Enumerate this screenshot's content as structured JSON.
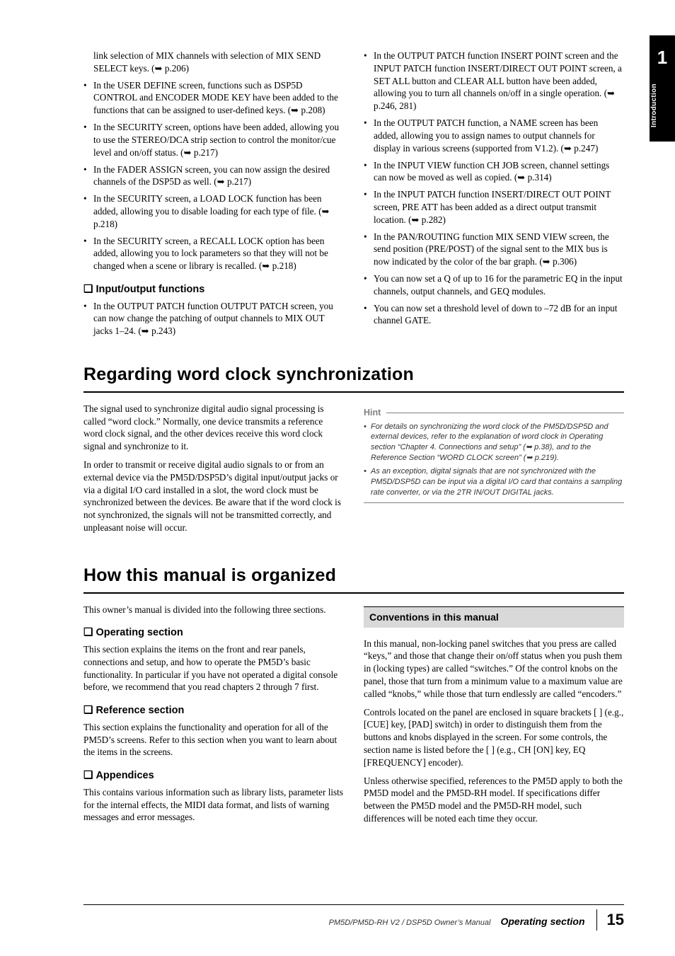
{
  "side": {
    "chapter_num": "1",
    "chapter_label": "Introduction"
  },
  "top": {
    "left": [
      {
        "text": "link selection of MIX channels with selection of MIX SEND SELECT keys. (➥ p.206)",
        "continuation": true
      },
      {
        "text": "In the USER DEFINE screen, functions such as DSP5D CONTROL and ENCODER MODE KEY have been added to the functions that can be assigned to user-defined keys. (➥ p.208)"
      },
      {
        "text": "In the SECURITY screen, options have been added, allowing you to use the STEREO/DCA strip section to control the monitor/cue level and on/off status. (➥ p.217)"
      },
      {
        "text": "In the FADER ASSIGN screen, you can now assign the desired channels of the DSP5D as well. (➥ p.217)"
      },
      {
        "text": "In the SECURITY screen, a LOAD LOCK function has been added, allowing you to disable loading for each type of file. (➥ p.218)"
      },
      {
        "text": "In the SECURITY screen, a RECALL LOCK option has been added, allowing you to lock parameters so that they will not be changed when a scene or library is recalled. (➥ p.218)"
      }
    ],
    "left_heading": "Input/output functions",
    "left2": [
      {
        "text": "In the OUTPUT PATCH function OUTPUT PATCH screen, you can now change the patching of output channels to MIX OUT jacks 1–24. (➥ p.243)"
      }
    ],
    "right": [
      {
        "text": "In the OUTPUT PATCH function INSERT POINT screen and the INPUT PATCH function INSERT/DIRECT OUT POINT screen, a SET ALL button and CLEAR ALL button have been added, allowing you to turn all channels on/off in a single operation. (➥ p.246, 281)"
      },
      {
        "text": "In the OUTPUT PATCH function, a NAME screen has been added, allowing you to assign names to output channels for display in various screens (supported from V1.2). (➥ p.247)"
      },
      {
        "text": "In the INPUT VIEW function CH JOB screen, channel settings can now be moved as well as copied. (➥ p.314)"
      },
      {
        "text": "In the INPUT PATCH function INSERT/DIRECT OUT POINT screen, PRE ATT has been added as a direct output transmit location. (➥ p.282)"
      },
      {
        "text": "In the PAN/ROUTING function MIX SEND VIEW screen, the send position (PRE/POST) of the signal sent to the MIX bus is now indicated by the color of the bar graph. (➥ p.306)"
      },
      {
        "text": "You can now set a Q of up to 16 for the parametric EQ in the input channels, output channels, and GEQ modules."
      },
      {
        "text": "You can now set a threshold level of down to –72 dB for an input channel GATE."
      }
    ]
  },
  "sec1": {
    "title": "Regarding word clock synchronization",
    "left_p1": "The signal used to synchronize digital audio signal processing is called “word clock.” Normally, one device transmits a reference word clock signal, and the other devices receive this word clock signal and synchronize to it.",
    "left_p2": "In order to transmit or receive digital audio signals to or from an external device via the PM5D/DSP5D’s digital input/output jacks or via a digital I/O card installed in a slot, the word clock must be synchronized between the devices. Be aware that if the word clock is not synchronized, the signals will not be transmitted correctly, and unpleasant noise will occur.",
    "hint_label": "Hint",
    "hints": [
      "For details on synchronizing the word clock of the PM5D/DSP5D and external devices, refer to the explanation of word clock in Operating section “Chapter 4. Connections and setup” (➥ p.38), and to the Reference Section “WORD CLOCK screen” (➥ p.219).",
      "As an exception, digital signals that are not synchronized with the PM5D/DSP5D can be input via a digital I/O card that contains a sampling rate converter, or via the 2TR IN/OUT DIGITAL jacks."
    ]
  },
  "sec2": {
    "title": "How this manual is organized",
    "intro": "This owner’s manual is divided into the following three sections.",
    "h_op": "Operating section",
    "p_op": "This section explains the items on the front and rear panels, connections and setup, and how to operate the PM5D’s basic functionality. In particular if you have not operated a digital console before, we recommend that you read chapters 2 through 7 first.",
    "h_ref": "Reference section",
    "p_ref": "This section explains the functionality and operation for all of the PM5D’s screens. Refer to this section when you want to learn about the items in the screens.",
    "h_app": "Appendices",
    "p_app": "This contains various information such as library lists, parameter lists for the internal effects, the MIDI data format, and lists of warning messages and error messages.",
    "conv_title": "Conventions in this manual",
    "conv_p1": "In this manual, non-locking panel switches that you press are called “keys,” and those that change their on/off status when you push them in (locking types) are called “switches.” Of the control knobs on the panel, those that turn from a minimum value to a maximum value are called “knobs,” while those that turn endlessly are called “encoders.”",
    "conv_p2": "Controls located on the panel are enclosed in square brackets [ ] (e.g., [CUE] key, [PAD] switch) in order to distinguish them from the buttons and knobs displayed in the screen. For some controls, the section name is listed before the [ ] (e.g., CH [ON] key, EQ [FREQUENCY] encoder).",
    "conv_p3": "Unless otherwise specified, references to the PM5D apply to both the PM5D model and the PM5D-RH model. If specifications differ between the PM5D model and the PM5D-RH model, such differences will be noted each time they occur."
  },
  "footer": {
    "manual": "PM5D/PM5D-RH V2 / DSP5D Owner’s Manual",
    "section": "Operating section",
    "page": "15"
  }
}
